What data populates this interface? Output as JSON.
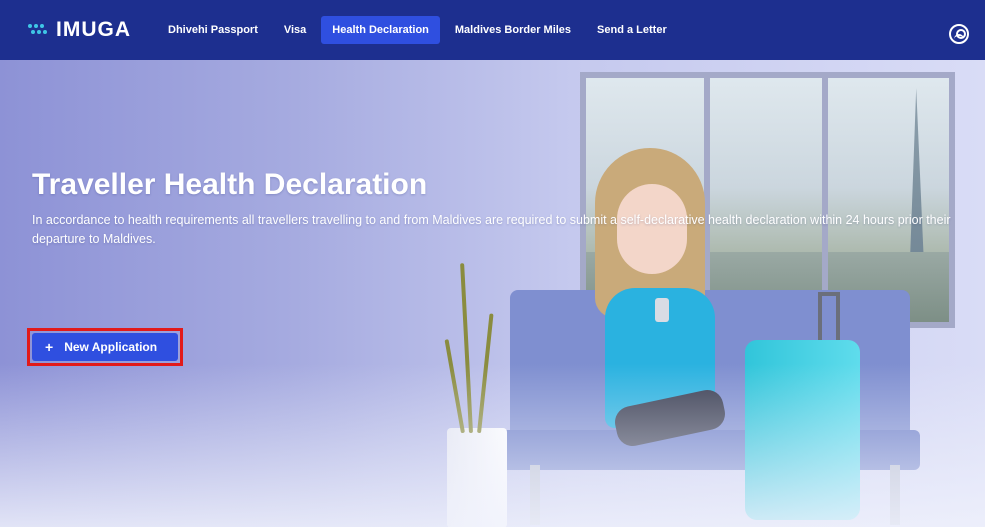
{
  "brand": {
    "name": "IMUGA"
  },
  "nav": {
    "items": [
      {
        "label": "Dhivehi Passport",
        "active": false
      },
      {
        "label": "Visa",
        "active": false
      },
      {
        "label": "Health Declaration",
        "active": true
      },
      {
        "label": "Maldives Border Miles",
        "active": false
      },
      {
        "label": "Send a Letter",
        "active": false
      }
    ],
    "account_icon": "user-circle-icon"
  },
  "hero": {
    "title": "Traveller Health Declaration",
    "description": "In accordance to health requirements all travellers travelling to and from Maldives are required to submit a self-declarative health declaration within 24 hours prior their departure to Maldives.",
    "cta": {
      "icon": "+",
      "label": "New Application"
    }
  },
  "colors": {
    "nav_bg": "#1d2f8f",
    "accent": "#2f4fe0",
    "brand_dots": "#3fc6e6",
    "highlight_border": "#e21a1a"
  }
}
